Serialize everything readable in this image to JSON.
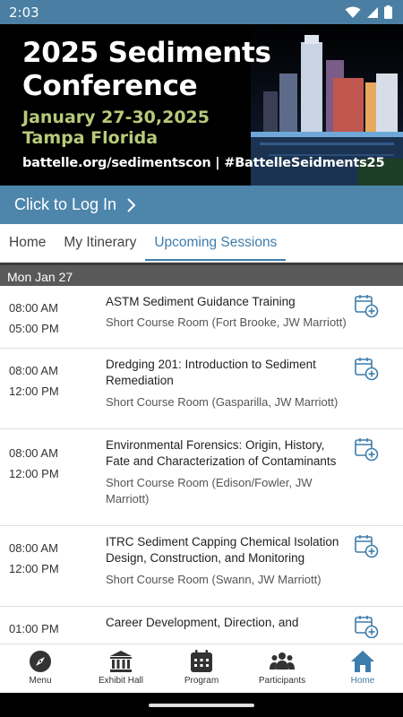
{
  "status_bar": {
    "time": "2:03"
  },
  "banner": {
    "title_line1": "2025 Sediments",
    "title_line2": "Conference",
    "dates_line1": "January 27-30,2025",
    "dates_line2": "Tampa Florida",
    "footer": "battelle.org/sedimentscon | #BattelleSeidments25"
  },
  "login": {
    "label": "Click to Log In"
  },
  "tabs": [
    {
      "label": "Home"
    },
    {
      "label": "My Itinerary"
    },
    {
      "label": "Upcoming Sessions"
    }
  ],
  "day_header": "Mon Jan 27",
  "sessions": [
    {
      "start": "08:00 AM",
      "end": "05:00 PM",
      "title": "ASTM Sediment Guidance Training",
      "room": "Short Course Room (Fort Brooke, JW Marriott)"
    },
    {
      "start": "08:00 AM",
      "end": "12:00 PM",
      "title": "Dredging 201: Introduction to Sediment Remediation",
      "room": "Short Course Room (Gasparilla, JW Marriott)"
    },
    {
      "start": "08:00 AM",
      "end": "12:00 PM",
      "title": "Environmental Forensics: Origin, History, Fate and Characterization of Contaminants",
      "room": "Short Course Room (Edison/Fowler, JW Marriott)"
    },
    {
      "start": "08:00 AM",
      "end": "12:00 PM",
      "title": "ITRC Sediment Capping Chemical Isolation Design, Construction, and Monitoring",
      "room": "Short Course Room (Swann, JW Marriott)"
    },
    {
      "start": "01:00 PM",
      "end": "",
      "title": "Career Development, Direction, and",
      "room": ""
    }
  ],
  "bottom_nav": [
    {
      "label": "Menu",
      "icon": "compass-icon"
    },
    {
      "label": "Exhibit Hall",
      "icon": "building-icon"
    },
    {
      "label": "Program",
      "icon": "calendar-icon"
    },
    {
      "label": "Participants",
      "icon": "people-icon"
    },
    {
      "label": "Home",
      "icon": "home-icon"
    }
  ],
  "colors": {
    "accent": "#3e7cab",
    "login_bar": "#4d85ab",
    "status_bar": "#4a7fa3",
    "banner_dates": "#b8c97a"
  }
}
